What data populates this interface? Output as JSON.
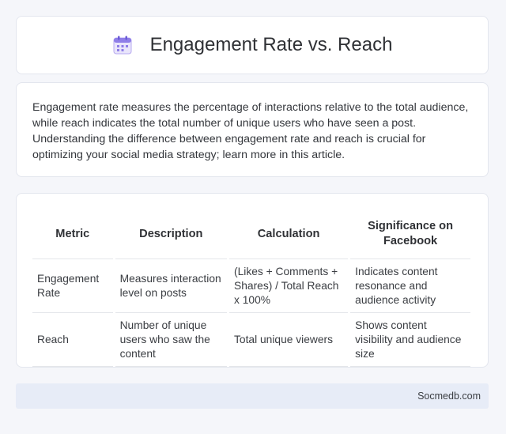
{
  "header": {
    "title": "Engagement Rate vs. Reach",
    "icon": "calendar-icon"
  },
  "intro": {
    "text": "Engagement rate measures the percentage of interactions relative to the total audience, while reach indicates the total number of unique users who have seen a post. Understanding the difference between engagement rate and reach is crucial for optimizing your social media strategy; learn more in this article."
  },
  "table": {
    "headers": [
      "Metric",
      "Description",
      "Calculation",
      "Significance on Facebook"
    ],
    "rows": [
      [
        "Engagement Rate",
        "Measures interaction level on posts",
        "(Likes + Comments + Shares) / Total Reach x 100%",
        "Indicates content resonance and audience activity"
      ],
      [
        "Reach",
        "Number of unique users who saw the content",
        "Total unique viewers",
        "Shows content visibility and audience size"
      ]
    ]
  },
  "footer": {
    "brand": "Socmedb.com"
  }
}
